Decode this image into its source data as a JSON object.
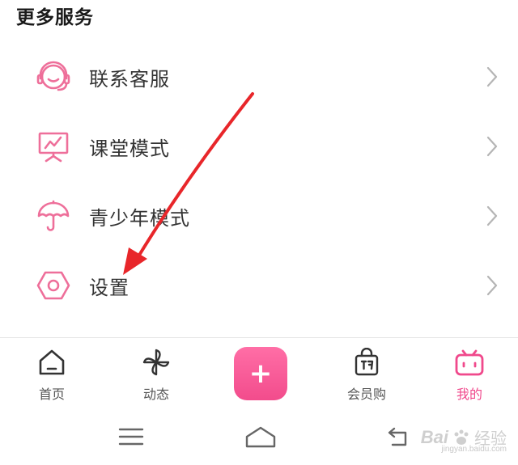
{
  "section": {
    "title": "更多服务"
  },
  "menu": [
    {
      "id": "customer-service",
      "label": "联系客服",
      "icon": "headset-icon"
    },
    {
      "id": "classroom-mode",
      "label": "课堂模式",
      "icon": "presentation-board-icon"
    },
    {
      "id": "teen-mode",
      "label": "青少年模式",
      "icon": "umbrella-icon"
    },
    {
      "id": "settings",
      "label": "设置",
      "icon": "hexagon-settings-icon"
    }
  ],
  "tabbar": {
    "tabs": [
      {
        "id": "home",
        "label": "首页",
        "icon": "home-icon",
        "active": false
      },
      {
        "id": "dynamic",
        "label": "动态",
        "icon": "pinwheel-icon",
        "active": false
      },
      {
        "id": "vip-shop",
        "label": "会员购",
        "icon": "shopping-bag-icon",
        "active": false
      },
      {
        "id": "mine",
        "label": "我的",
        "icon": "tv-mascot-icon",
        "active": true
      }
    ],
    "fab_symbol": "+"
  },
  "watermark": {
    "brand": "Bai",
    "brand_suffix": "经验",
    "url": "jingyan.baidu.com"
  },
  "colors": {
    "accent_pink": "#f0498c",
    "icon_pink": "#ee6f9a",
    "annotation_red": "#e8262a",
    "text_primary": "#333333",
    "chevron_gray": "#b5b5b5"
  }
}
